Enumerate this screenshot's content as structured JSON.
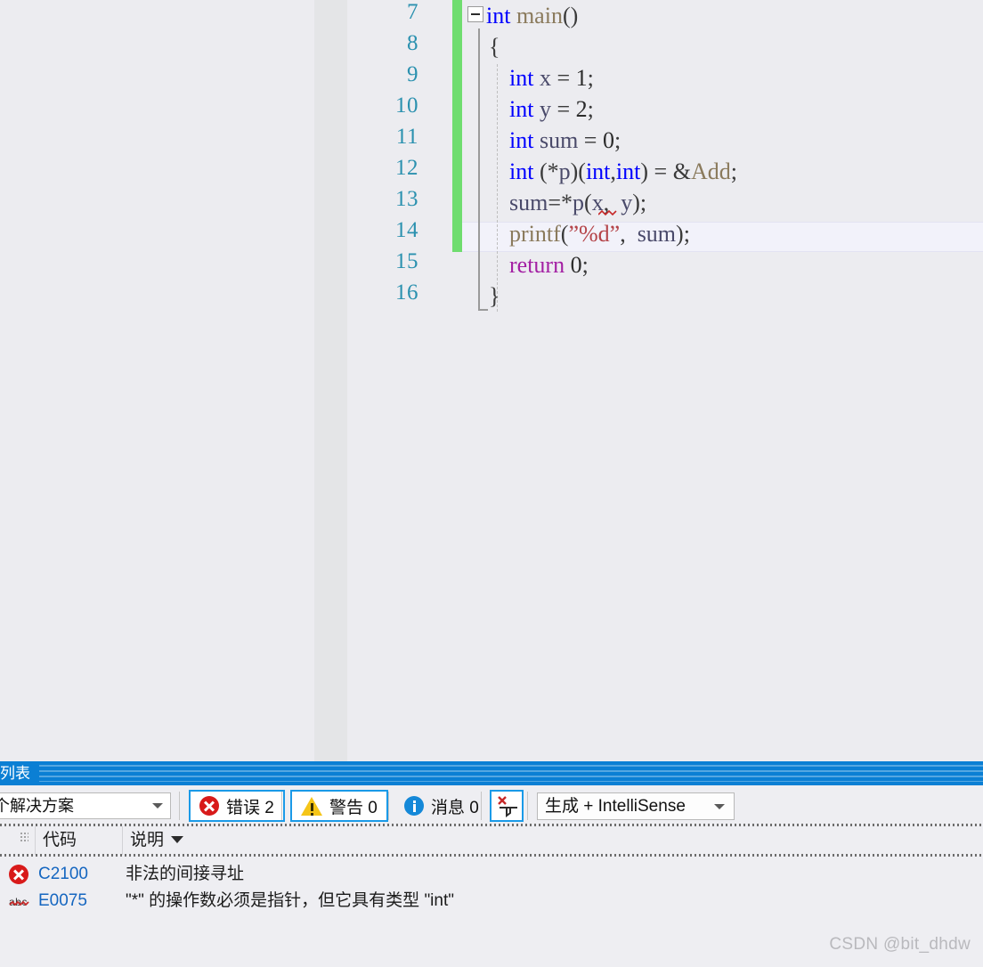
{
  "editor": {
    "language": "c",
    "first_line_number": 7,
    "current_line_number": 14,
    "fold_marker": "collapse-minus-icon",
    "lines": [
      {
        "n": "7",
        "code": "int main()"
      },
      {
        "n": "8",
        "code": "{"
      },
      {
        "n": "9",
        "code": "    int x = 1;"
      },
      {
        "n": "10",
        "code": "    int y = 2;"
      },
      {
        "n": "11",
        "code": "    int sum = 0;"
      },
      {
        "n": "12",
        "code": "    int (*p)(int,int) = &Add;"
      },
      {
        "n": "13",
        "code": "    sum=*p(x, y);"
      },
      {
        "n": "14",
        "code": "    printf(\"%d\", sum);"
      },
      {
        "n": "15",
        "code": "    return 0;"
      },
      {
        "n": "16",
        "code": "}"
      }
    ],
    "colors": {
      "background": "#ececf0",
      "line_number": "#2b91af",
      "keyword": "#0000ff",
      "control_keyword": "#a31fa3",
      "function": "#8a7a5c",
      "string": "#b5454a",
      "identifier": "#4a4a6a",
      "change_bar": "#6fdd6f",
      "current_line_highlight": "#f2f2fa"
    }
  },
  "error_panel": {
    "title": "列表",
    "title_bar_color": "#0b7fd4",
    "toolbar": {
      "scope_value": "个解决方案",
      "errors_label": "错误 2",
      "errors_count": 2,
      "warnings_label": "警告 0",
      "warnings_count": 0,
      "messages_label": "消息 0",
      "messages_count": 0,
      "filter_icon": "clear-filter-icon",
      "build_filter_value": "生成 + IntelliSense"
    },
    "columns": [
      {
        "key": "icon",
        "label": ""
      },
      {
        "key": "code",
        "label": "代码"
      },
      {
        "key": "description",
        "label": "说明",
        "sorted": "desc"
      }
    ],
    "rows": [
      {
        "icon": "error-icon",
        "code": "C2100",
        "description": "非法的间接寻址"
      },
      {
        "icon": "intellisense-icon",
        "code": "E0075",
        "description": "\"*\" 的操作数必须是指针，但它具有类型 \"int\""
      }
    ]
  },
  "watermark": "CSDN @bit_dhdw"
}
